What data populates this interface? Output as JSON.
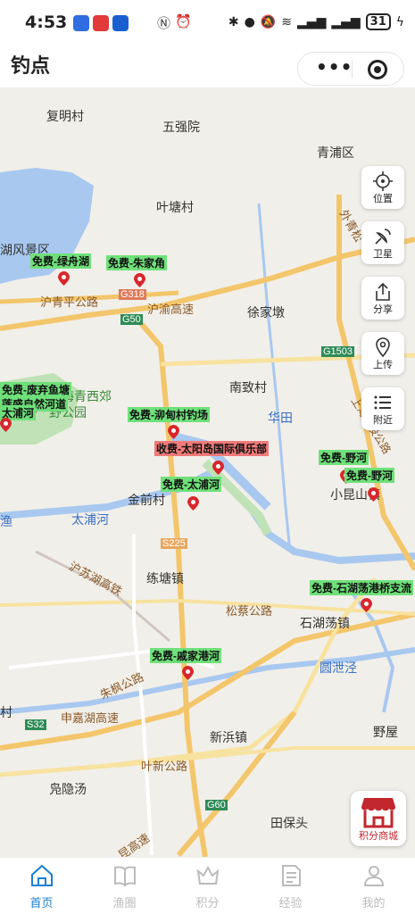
{
  "status_bar": {
    "time": "4:53",
    "battery": "31"
  },
  "header": {
    "title": "钓点"
  },
  "map": {
    "places": [
      {
        "id": "fuming",
        "text": "复明村"
      },
      {
        "id": "wuqiang",
        "text": "五强院"
      },
      {
        "id": "qingpu",
        "text": "青浦区"
      },
      {
        "id": "yetang",
        "text": "叶塘村"
      },
      {
        "id": "hufeng",
        "text": "湖风景区"
      },
      {
        "id": "huqingping",
        "text": "沪青平公路"
      },
      {
        "id": "g318",
        "text": "G318"
      },
      {
        "id": "g50",
        "text": "G50"
      },
      {
        "id": "huyu",
        "text": "沪渝高速"
      },
      {
        "id": "xujiadun",
        "text": "徐家墩"
      },
      {
        "id": "g1503",
        "text": "G1503"
      },
      {
        "id": "nanzhi",
        "text": "南致村"
      },
      {
        "id": "qingxi",
        "text": "上海青西郊"
      },
      {
        "id": "park",
        "text": "野公园"
      },
      {
        "id": "huatian",
        "text": "华田"
      },
      {
        "id": "jinqian",
        "text": "金前村"
      },
      {
        "id": "taipu",
        "text": "太浦河"
      },
      {
        "id": "yu",
        "text": "渔"
      },
      {
        "id": "xiaokun",
        "text": "小昆山镇"
      },
      {
        "id": "s225",
        "text": "S225"
      },
      {
        "id": "husuhu",
        "text": "沪苏湖高铁"
      },
      {
        "id": "liantang",
        "text": "练塘镇"
      },
      {
        "id": "songze",
        "text": "松蔡公路"
      },
      {
        "id": "shihudang",
        "text": "石湖荡镇"
      },
      {
        "id": "zhufeng",
        "text": "朱枫公路"
      },
      {
        "id": "yuanxie",
        "text": "圆泄泾"
      },
      {
        "id": "cun",
        "text": "村"
      },
      {
        "id": "hujiahu",
        "text": "申嘉湖高速"
      },
      {
        "id": "s32",
        "text": "S32"
      },
      {
        "id": "xinbin",
        "text": "新浜镇"
      },
      {
        "id": "yewu",
        "text": "野屋"
      },
      {
        "id": "yexin",
        "text": "叶新公路"
      },
      {
        "id": "fuyintang",
        "text": "凫隐汤"
      },
      {
        "id": "g60",
        "text": "G60"
      },
      {
        "id": "tianbao",
        "text": "田保头"
      },
      {
        "id": "kungao",
        "text": "昆高速"
      },
      {
        "id": "waiqing",
        "text": "外青松"
      },
      {
        "id": "shangkun",
        "text": "上海城投公路"
      }
    ],
    "spots": [
      {
        "id": "lvzhou",
        "text": "免费-绿舟湖",
        "type": "free"
      },
      {
        "id": "zhujia",
        "text": "免费-朱家角",
        "type": "free"
      },
      {
        "id": "feiqi",
        "text": "免费-废弃鱼塘",
        "type": "free"
      },
      {
        "id": "lianshengtang",
        "text": "莲盛自然河道",
        "type": "free"
      },
      {
        "id": "taipu-w",
        "text": "太浦河",
        "type": "free"
      },
      {
        "id": "mengdian",
        "text": "免费-泖甸村钓场",
        "type": "free"
      },
      {
        "id": "taiyangdao",
        "text": "收费-太阳岛国际俱乐部",
        "type": "paid"
      },
      {
        "id": "taipu",
        "text": "免费-太浦河",
        "type": "free"
      },
      {
        "id": "yehe1",
        "text": "免费-野河",
        "type": "free"
      },
      {
        "id": "yehe2",
        "text": "免费-野河",
        "type": "free"
      },
      {
        "id": "shihudang",
        "text": "免费-石湖荡港桥支流",
        "type": "free"
      },
      {
        "id": "qijia",
        "text": "免费-戚家港河",
        "type": "free"
      }
    ]
  },
  "side_buttons": [
    {
      "id": "location",
      "label": "位置",
      "icon": "crosshair-icon"
    },
    {
      "id": "satellite",
      "label": "卫星",
      "icon": "satellite-icon"
    },
    {
      "id": "share",
      "label": "分享",
      "icon": "share-icon"
    },
    {
      "id": "upload",
      "label": "上传",
      "icon": "map-pin-icon"
    },
    {
      "id": "nearby",
      "label": "附近",
      "icon": "list-icon"
    }
  ],
  "shop": {
    "label": "积分商城",
    "icon": "storefront-icon"
  },
  "tabs": [
    {
      "id": "home",
      "label": "首页",
      "icon": "home-icon",
      "active": true
    },
    {
      "id": "circle",
      "label": "渔圈",
      "icon": "book-icon",
      "active": false
    },
    {
      "id": "points",
      "label": "积分",
      "icon": "crown-icon",
      "active": false
    },
    {
      "id": "experience",
      "label": "经验",
      "icon": "document-icon",
      "active": false
    },
    {
      "id": "mine",
      "label": "我的",
      "icon": "user-icon",
      "active": false
    }
  ],
  "colors": {
    "accent": "#1a7fd4",
    "free_label": "#6fe07a",
    "paid_label": "#f07a7a",
    "pin": "#d9262c",
    "water": "#a8c8f0",
    "highway": "#f3c66b"
  }
}
